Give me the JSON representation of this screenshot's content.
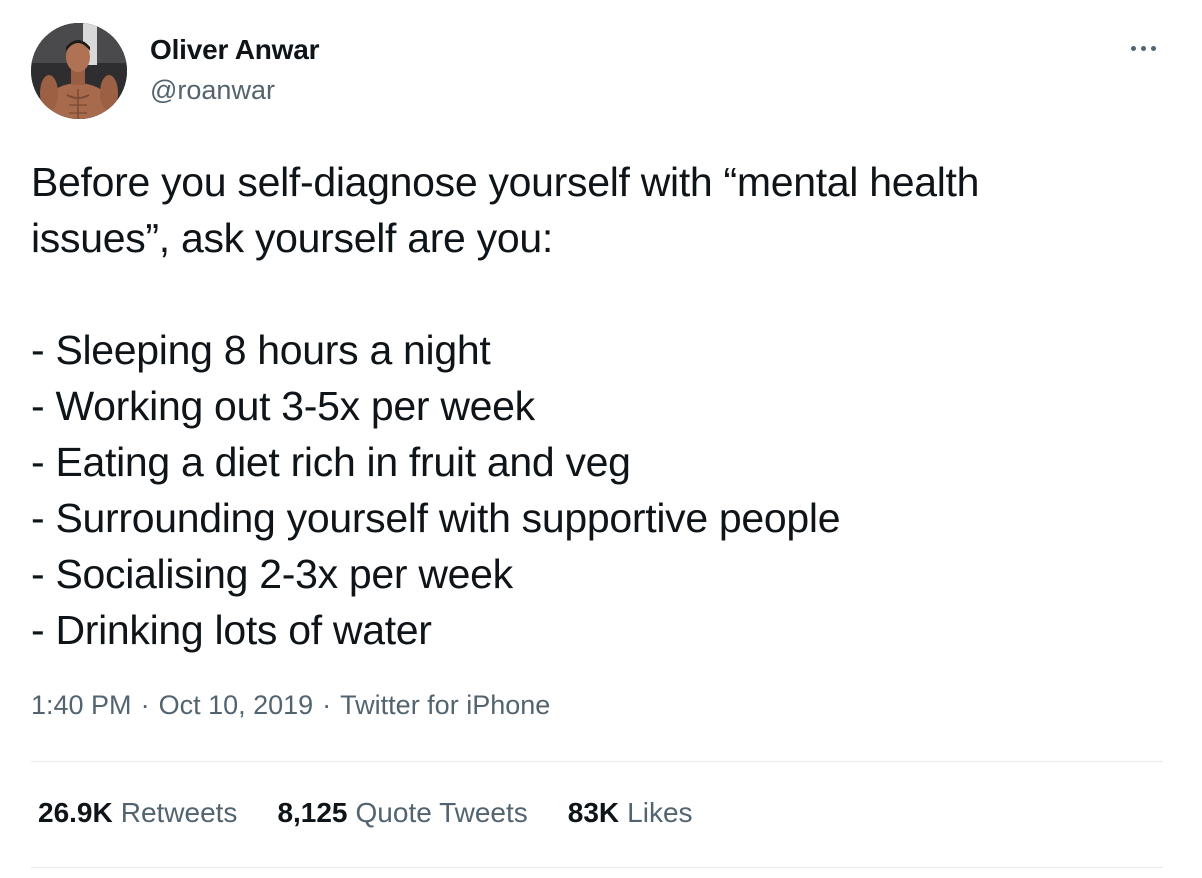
{
  "author": {
    "name": "Oliver Anwar",
    "handle": "@roanwar",
    "avatar_icon": "profile-photo-avatar"
  },
  "tweet": {
    "intro_lines": [
      "Before you self-diagnose yourself with “mental health",
      "issues”, ask yourself are you:"
    ],
    "list_lines": [
      "- Sleeping 8 hours a night",
      "- Working out 3-5x per week",
      "- Eating a diet rich in fruit and veg",
      "- Surrounding yourself with supportive people",
      "- Socialising 2-3x per week",
      "- Drinking lots of water"
    ]
  },
  "meta": {
    "time": "1:40 PM",
    "date": "Oct 10, 2019",
    "source": "Twitter for iPhone",
    "separator": "·"
  },
  "stats": {
    "retweets_count": "26.9K",
    "retweets_label": "Retweets",
    "quotes_count": "8,125",
    "quotes_label": "Quote Tweets",
    "likes_count": "83K",
    "likes_label": "Likes"
  },
  "colors": {
    "text_primary": "#0f1419",
    "text_secondary": "#536471",
    "divider": "#e6ebee",
    "background": "#ffffff"
  }
}
